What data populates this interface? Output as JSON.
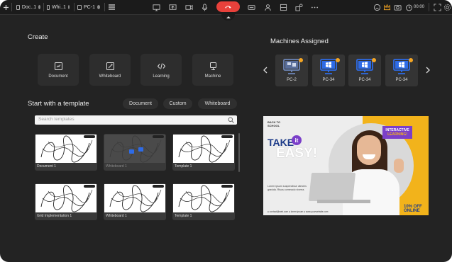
{
  "tabs": [
    {
      "label": "Doc..1",
      "active": true
    },
    {
      "label": "Whi..1",
      "active": false
    },
    {
      "label": "PC-1",
      "active": false
    }
  ],
  "toolbar": {
    "timer": "00:00",
    "tools": [
      "whiteboard-icon",
      "screen-share-icon",
      "video-icon",
      "microphone-icon",
      "end-call-icon",
      "chat-icon",
      "person-icon",
      "layout-icon",
      "apps-icon",
      "more-icon"
    ],
    "right_tools": [
      "emoji-icon",
      "crown-icon",
      "camera-icon",
      "clock-icon",
      "settings-icon"
    ]
  },
  "create": {
    "title": "Create",
    "items": [
      {
        "label": "Document",
        "icon": "document-icon"
      },
      {
        "label": "Whiteboard",
        "icon": "whiteboard-icon"
      },
      {
        "label": "Learning",
        "icon": "code-icon"
      },
      {
        "label": "Machine",
        "icon": "monitor-icon"
      }
    ]
  },
  "templates": {
    "title": "Start with a template",
    "filters": [
      "Document",
      "Custom",
      "Whiteboard"
    ],
    "search_placeholder": "Search templates",
    "items": [
      {
        "name": "Document 1"
      },
      {
        "name": "Whiteboard 1"
      },
      {
        "name": "Template 1"
      },
      {
        "name": "Grid Implementation 1"
      },
      {
        "name": "Whiteboard 1"
      },
      {
        "name": "Template 1"
      }
    ]
  },
  "machines": {
    "title": "Machines Assigned",
    "items": [
      {
        "label": "PC-2",
        "style": "grey"
      },
      {
        "label": "PC-34",
        "style": "blue"
      },
      {
        "label": "PC-34",
        "style": "blue"
      },
      {
        "label": "PC-34",
        "style": "blue"
      }
    ]
  },
  "banner": {
    "kicker": "BACK TO\nSCHOOL",
    "take": "TAKE",
    "it": "it",
    "easy": "EASY!",
    "description": "Lorem ipsum suspendisse ultricies gravida. Risus commodo viverra.",
    "interactive": "INTERACTIVE",
    "learning": "LEARNING!",
    "discount": "10% OFF",
    "online": "ONLINE",
    "footer": "● contact@web.com   ● lorem ipsum   ● www.yourwebsite.com",
    "colors": {
      "accent_purple": "#7b3fc9",
      "accent_yellow": "#f2b31b",
      "headline_blue": "#1f3d8a"
    }
  },
  "colors": {
    "end_call": "#e8413b",
    "machine_blue": "#2e6be6",
    "status_dot": "#f5a623"
  }
}
